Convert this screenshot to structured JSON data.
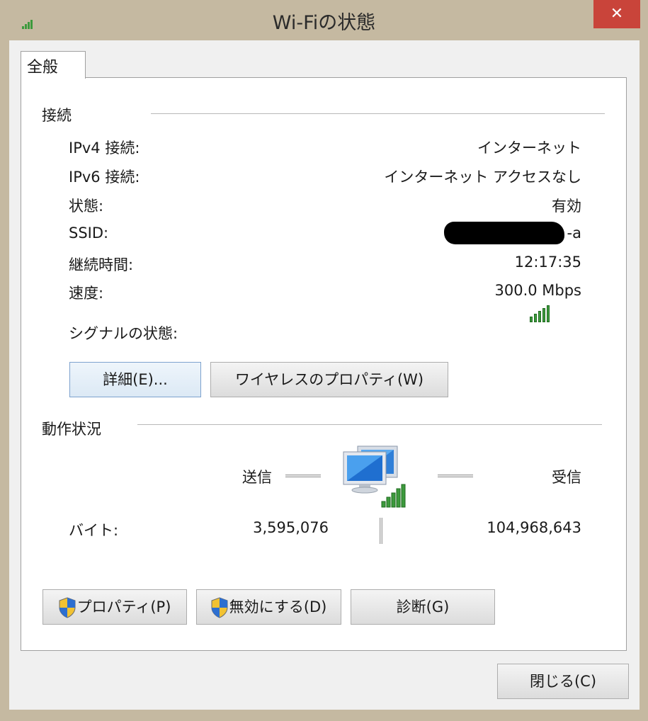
{
  "window": {
    "title": "Wi-Fiの状態",
    "close_glyph": "✕"
  },
  "tab": {
    "label": "全般"
  },
  "connection": {
    "section_title": "接続",
    "rows": [
      {
        "label": "IPv4 接続:",
        "value": "インターネット"
      },
      {
        "label": "IPv6 接続:",
        "value": "インターネット アクセスなし"
      },
      {
        "label": "状態:",
        "value": "有効"
      },
      {
        "label": "SSID:",
        "value": "-a"
      },
      {
        "label": "継続時間:",
        "value": "12:17:35"
      },
      {
        "label": "速度:",
        "value": "300.0 Mbps"
      }
    ],
    "signal_label": "シグナルの状態:",
    "signal_bars": 5,
    "details_button": "詳細(E)...",
    "wireless_props_button": "ワイヤレスのプロパティ(W)"
  },
  "activity": {
    "section_title": "動作状況",
    "sent_label": "送信",
    "received_label": "受信",
    "bytes_label": "バイト:",
    "bytes_sent": "3,595,076",
    "bytes_received": "104,968,643"
  },
  "buttons": {
    "properties": "プロパティ(P)",
    "disable": "無効にする(D)",
    "diagnose": "診断(G)",
    "close": "閉じる(C)"
  },
  "colors": {
    "close_red": "#c9443a",
    "signal_green": "#3d9a3d",
    "frame": "#c5b9a1"
  },
  "icons": [
    "signal-icon",
    "network-computers-icon",
    "uac-shield-icon",
    "close-icon"
  ]
}
